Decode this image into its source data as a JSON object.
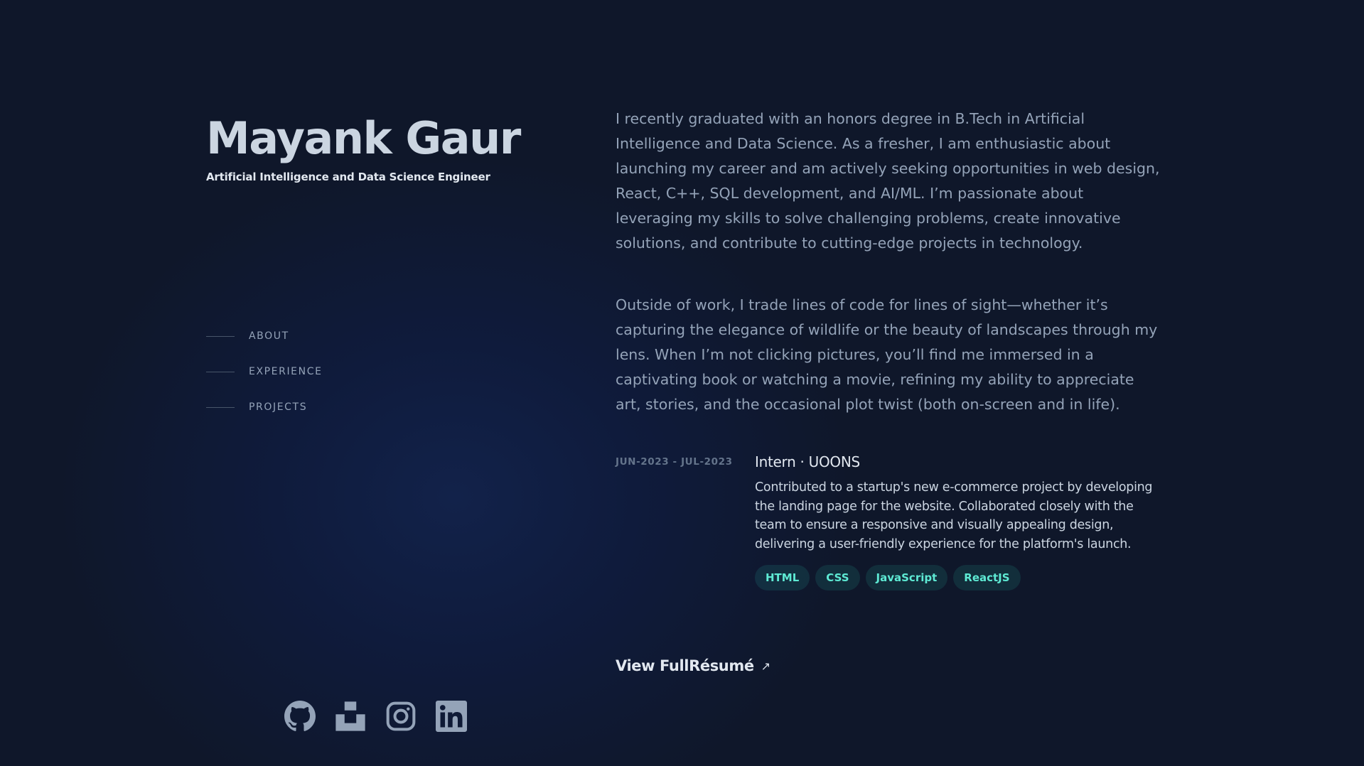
{
  "header": {
    "name": "Mayank Gaur",
    "role": "Artificial Intelligence and Data Science Engineer"
  },
  "nav": {
    "items": [
      {
        "label": "ABOUT"
      },
      {
        "label": "EXPERIENCE"
      },
      {
        "label": "PROJECTS"
      }
    ]
  },
  "socials": {
    "icons": [
      "github-icon",
      "unsplash-icon",
      "instagram-icon",
      "linkedin-icon"
    ]
  },
  "about": {
    "paragraphs": [
      "I recently graduated with an honors degree in B.Tech in Artificial Intelligence and Data Science. As a fresher, I am enthusiastic about launching my career and am actively seeking opportunities in web design, React, C++, SQL development, and AI/ML. I’m passionate about leveraging my skills to solve challenging problems, create innovative solutions, and contribute to cutting-edge projects in technology.",
      "Outside of work, I trade lines of code for lines of sight—whether it’s capturing the elegance of wildlife or the beauty of landscapes through my lens. When I’m not clicking pictures, you’ll find me immersed in a captivating book or watching a movie, refining my ability to appreciate art, stories, and the occasional plot twist (both on-screen and in life)."
    ]
  },
  "experience": {
    "date": "JUN-2023 - JUL-2023",
    "title": "Intern · UOONS",
    "description": "Contributed to a startup's new e-commerce project by developing the landing page for the website. Collaborated closely with the team to ensure a responsive and visually appealing design, delivering a user-friendly experience for the platform's launch.",
    "tags": [
      "HTML",
      "CSS",
      "JavaScript",
      "ReactJS"
    ]
  },
  "resume": {
    "label": "View FullRésumé",
    "arrow": "↗"
  },
  "colors": {
    "background": "#0f172a",
    "accent": "#5eead4",
    "text": "#94a3b8",
    "heading": "#cbd5e1"
  }
}
